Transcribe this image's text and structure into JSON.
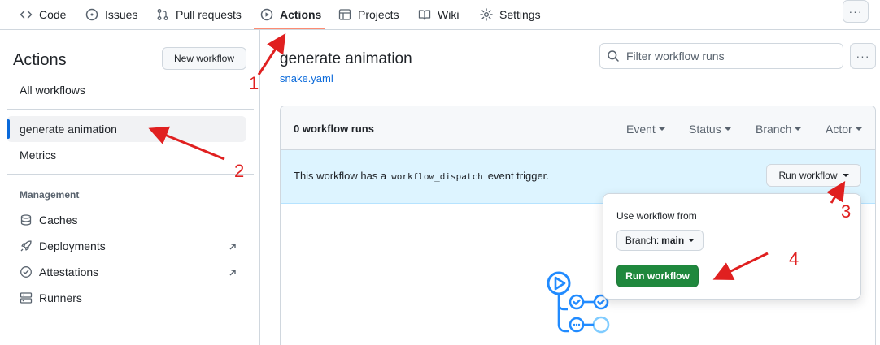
{
  "nav": {
    "tabs": [
      {
        "label": "Code",
        "icon": "code-icon"
      },
      {
        "label": "Issues",
        "icon": "issue-icon"
      },
      {
        "label": "Pull requests",
        "icon": "pull-request-icon"
      },
      {
        "label": "Actions",
        "icon": "play-icon",
        "active": true
      },
      {
        "label": "Projects",
        "icon": "table-icon"
      },
      {
        "label": "Wiki",
        "icon": "book-icon"
      },
      {
        "label": "Settings",
        "icon": "gear-icon"
      }
    ],
    "more_label": "···"
  },
  "sidebar": {
    "title": "Actions",
    "new_workflow_label": "New workflow",
    "all_workflows": "All workflows",
    "workflows": [
      "generate animation",
      "Metrics"
    ],
    "management_heading": "Management",
    "management": [
      {
        "label": "Caches",
        "icon": "cache-icon",
        "external": false
      },
      {
        "label": "Deployments",
        "icon": "rocket-icon",
        "external": true
      },
      {
        "label": "Attestations",
        "icon": "verified-icon",
        "external": true
      },
      {
        "label": "Runners",
        "icon": "server-icon",
        "external": false
      }
    ]
  },
  "main": {
    "workflow_name": "generate animation",
    "workflow_file": "snake.yaml",
    "filter_placeholder": "Filter workflow runs",
    "kebab_label": "···",
    "runs_count": "0 workflow runs",
    "filters": [
      "Event",
      "Status",
      "Branch",
      "Actor"
    ],
    "dispatch_prefix": "This workflow has a",
    "dispatch_code": "workflow_dispatch",
    "dispatch_suffix": "event trigger.",
    "run_workflow_label": "Run workflow"
  },
  "popover": {
    "label": "Use workflow from",
    "branch_prefix": "Branch:",
    "branch_value": "main",
    "run_label": "Run workflow"
  },
  "annotations": [
    "1",
    "2",
    "3",
    "4"
  ],
  "colors": {
    "accent": "#0969da",
    "active_underline": "#fd8c73",
    "primary_button": "#1f883d",
    "dispatch_bg": "#ddf4ff",
    "annotation": "#e02020"
  }
}
